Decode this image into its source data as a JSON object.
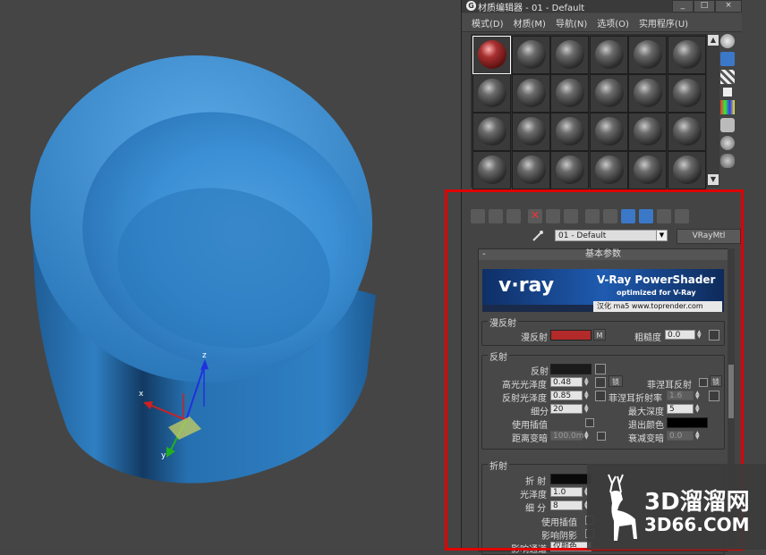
{
  "window": {
    "title": "材质编辑器 - 01 - Default",
    "logo_glyph": "G",
    "controls": [
      "_",
      "□",
      "×"
    ]
  },
  "menu": [
    "模式(D)",
    "材质(M)",
    "导航(N)",
    "选项(O)",
    "实用程序(U)"
  ],
  "material_slots": {
    "rows": 4,
    "cols": 6,
    "selected_index": 0,
    "selected_color": "#a83030"
  },
  "material_name": "01 - Default",
  "material_type": "VRayMtl",
  "rollout_title": "基本参数",
  "rollout_toggle": "-",
  "banner": {
    "logo": "v·ray",
    "product": "V-Ray PowerShader",
    "tagline": "optimized for V-Ray",
    "credit": "汉化 ma5 www.toprender.com"
  },
  "diffuse": {
    "group_label": "漫反射",
    "diffuse_label": "漫反射",
    "diffuse_color": "#b22a2a",
    "map_button": "M",
    "roughness_label": "粗糙度",
    "roughness_value": "0.0"
  },
  "reflection": {
    "group_label": "反射",
    "reflect_label": "反射",
    "reflect_color": "#1a1a1a",
    "hilight_gloss_label": "高光光泽度",
    "hilight_gloss_value": "0.48",
    "lock_label": "锁",
    "fresnel_label": "菲涅耳反射",
    "fresnel_lock_label": "锁",
    "refl_gloss_label": "反射光泽度",
    "refl_gloss_value": "0.85",
    "fresnel_ior_label": "菲涅耳折射率",
    "fresnel_ior_value": "1.6",
    "subdivs_label": "细分",
    "subdivs_value": "20",
    "max_depth_label": "最大深度",
    "max_depth_value": "5",
    "use_interp_label": "使用插值",
    "exit_color_label": "退出颜色",
    "exit_color": "#000000",
    "dim_dist_label": "距离变暗",
    "dim_dist_value": "100.0m",
    "dim_falloff_label": "衰减变暗",
    "dim_falloff_value": "0.0"
  },
  "refraction": {
    "group_label": "折射",
    "refract_label": "折 射",
    "refract_color": "#0a0a0a",
    "gloss_label": "光泽度",
    "gloss_value": "1.0",
    "subdivs_label": "细 分",
    "subdivs_value": "8",
    "use_interp_label": "使用插值",
    "affect_shadows_label": "影响阴影",
    "affect_channels_label": "影响通道",
    "affect_channels_value": "仅颜色"
  },
  "gizmo_axes": {
    "x": "x",
    "y": "y",
    "z": "z"
  },
  "watermark": {
    "line1": "3D溜溜网",
    "line2": "3D66.COM"
  },
  "colors": {
    "chair_blue": "#2f7fc2",
    "viewport_bg": "#454545",
    "highlight_frame": "#e00000",
    "active_tool": "#3b78c8"
  }
}
